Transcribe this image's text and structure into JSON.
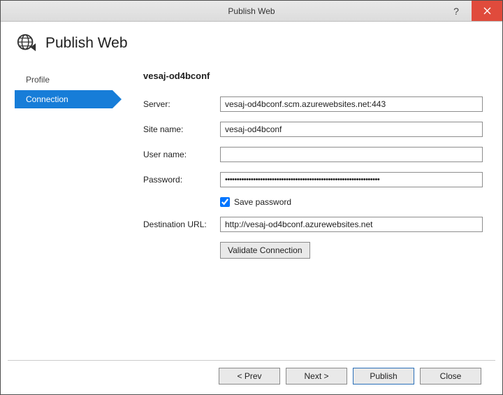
{
  "window": {
    "title": "Publish Web"
  },
  "header": {
    "title": "Publish Web"
  },
  "sidebar": {
    "items": [
      {
        "label": "Profile",
        "active": false
      },
      {
        "label": "Connection",
        "active": true
      }
    ]
  },
  "content": {
    "title": "vesaj-od4bconf",
    "fields": {
      "server": {
        "label": "Server:",
        "value": "vesaj-od4bconf.scm.azurewebsites.net:443"
      },
      "site_name": {
        "label": "Site name:",
        "value": "vesaj-od4bconf"
      },
      "user_name": {
        "label": "User name:",
        "value": ""
      },
      "password": {
        "label": "Password:",
        "value": "••••••••••••••••••••••••••••••••••••••••••••••••••••••••••••••••••"
      },
      "save_password": {
        "label": "Save password",
        "checked": true
      },
      "destination_url": {
        "label": "Destination URL:",
        "value": "http://vesaj-od4bconf.azurewebsites.net"
      }
    },
    "validate_label": "Validate Connection"
  },
  "footer": {
    "prev": "< Prev",
    "next": "Next >",
    "publish": "Publish",
    "close": "Close"
  }
}
